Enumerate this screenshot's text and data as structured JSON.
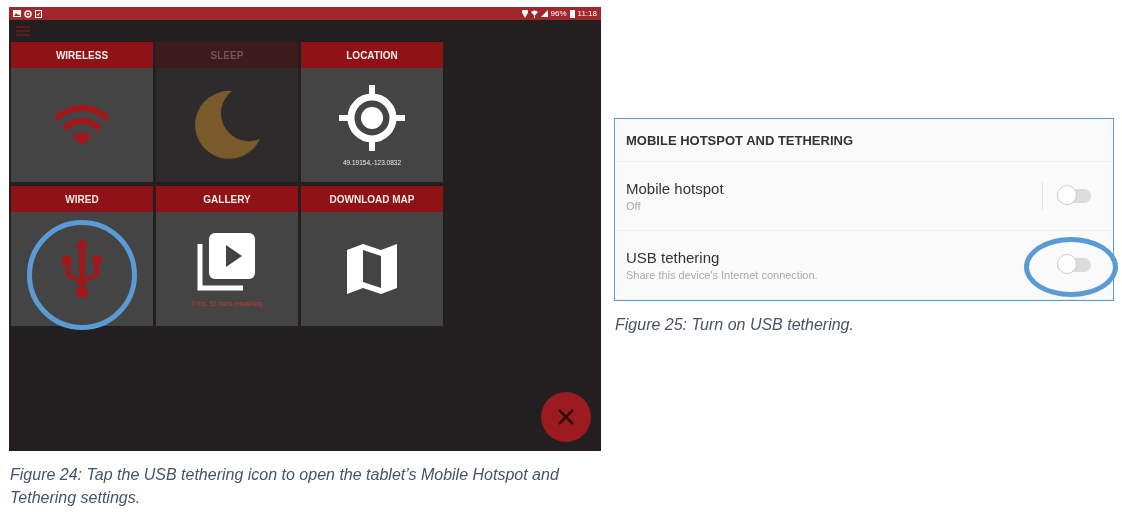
{
  "tablet_screen": {
    "status_bar": {
      "battery": "96%",
      "time": "11:18"
    },
    "tiles": [
      {
        "label": "WIRELESS",
        "kind": "wifi",
        "disabled": false
      },
      {
        "label": "SLEEP",
        "kind": "moon",
        "disabled": true
      },
      {
        "label": "LOCATION",
        "kind": "crosshair",
        "disabled": false,
        "detail": "49.19154,-123.0832"
      },
      {
        "label": "WIRED",
        "kind": "usb",
        "disabled": false
      },
      {
        "label": "GALLERY",
        "kind": "gallery",
        "disabled": false,
        "detail": "0 hrs, 52 mins remaining"
      },
      {
        "label": "DOWNLOAD MAP",
        "kind": "map",
        "disabled": false
      }
    ]
  },
  "figure_24_caption": "Figure 24: Tap the USB tethering icon to open the tablet’s Mobile Hotspot and Tethering settings.",
  "settings": {
    "header": "MOBILE HOTSPOT AND TETHERING",
    "rows": [
      {
        "title": "Mobile hotspot",
        "subtitle": "Off",
        "on": false
      },
      {
        "title": "USB tethering",
        "subtitle": "Share this device's Internet connection.",
        "on": false
      }
    ]
  },
  "figure_25_caption": "Figure 25: Turn on USB tethering."
}
